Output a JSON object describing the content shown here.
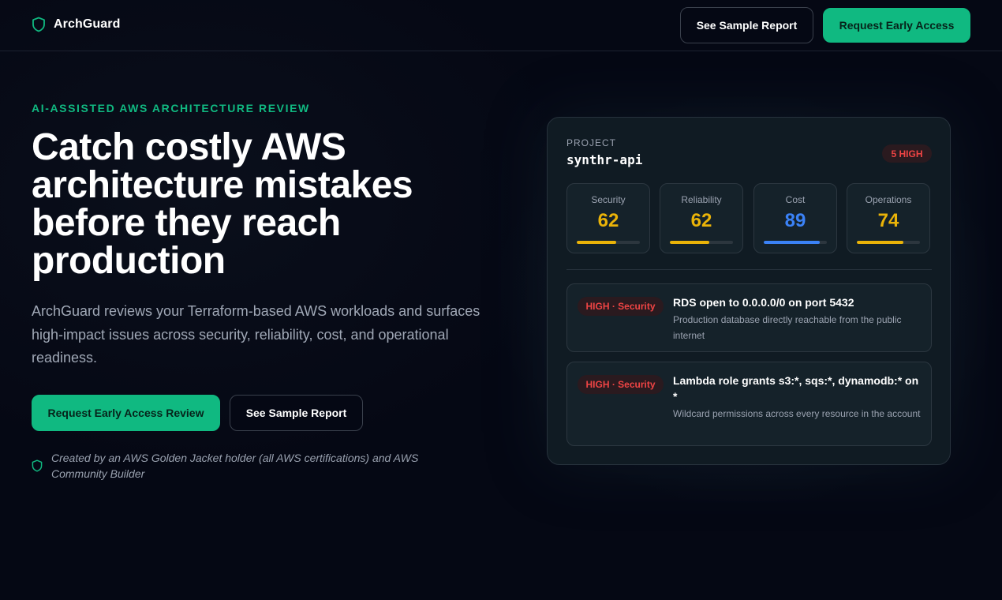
{
  "brand": {
    "name": "ArchGuard",
    "icon": "shield-icon"
  },
  "header": {
    "sample_label": "See Sample Report",
    "access_label": "Request Early Access"
  },
  "hero": {
    "eyebrow": "AI-ASSISTED AWS ARCHITECTURE REVIEW",
    "title": "Catch costly AWS architecture mistakes before they reach production",
    "description": "ArchGuard reviews your Terraform-based AWS workloads and surfaces high-impact issues across security, reliability, cost, and operational readiness.",
    "cta_primary": "Request Early Access Review",
    "cta_secondary": "See Sample Report",
    "credit": "Created by an AWS Golden Jacket holder (all AWS certifications) and AWS Community Builder"
  },
  "card": {
    "project_label": "PROJECT",
    "project_name": "synthr-api",
    "severity_badge": "5 HIGH",
    "metrics": [
      {
        "label": "Security",
        "value": "62",
        "percent": 62,
        "color": "#eab308"
      },
      {
        "label": "Reliability",
        "value": "62",
        "percent": 62,
        "color": "#eab308"
      },
      {
        "label": "Cost",
        "value": "89",
        "percent": 89,
        "color": "#3b82f6"
      },
      {
        "label": "Operations",
        "value": "74",
        "percent": 74,
        "color": "#eab308"
      }
    ],
    "findings": [
      {
        "badge": "HIGH · Security",
        "title": "RDS open to 0.0.0.0/0 on port 5432",
        "description": "Production database directly reachable from the public internet"
      },
      {
        "badge": "HIGH · Security",
        "title": "Lambda role grants s3:*, sqs:*, dynamodb:* on *",
        "description": "Wildcard permissions across every resource in the account"
      }
    ]
  },
  "colors": {
    "accent": "#10b981",
    "danger": "#ef4444",
    "warning": "#eab308",
    "info": "#3b82f6",
    "background": "#050814"
  }
}
